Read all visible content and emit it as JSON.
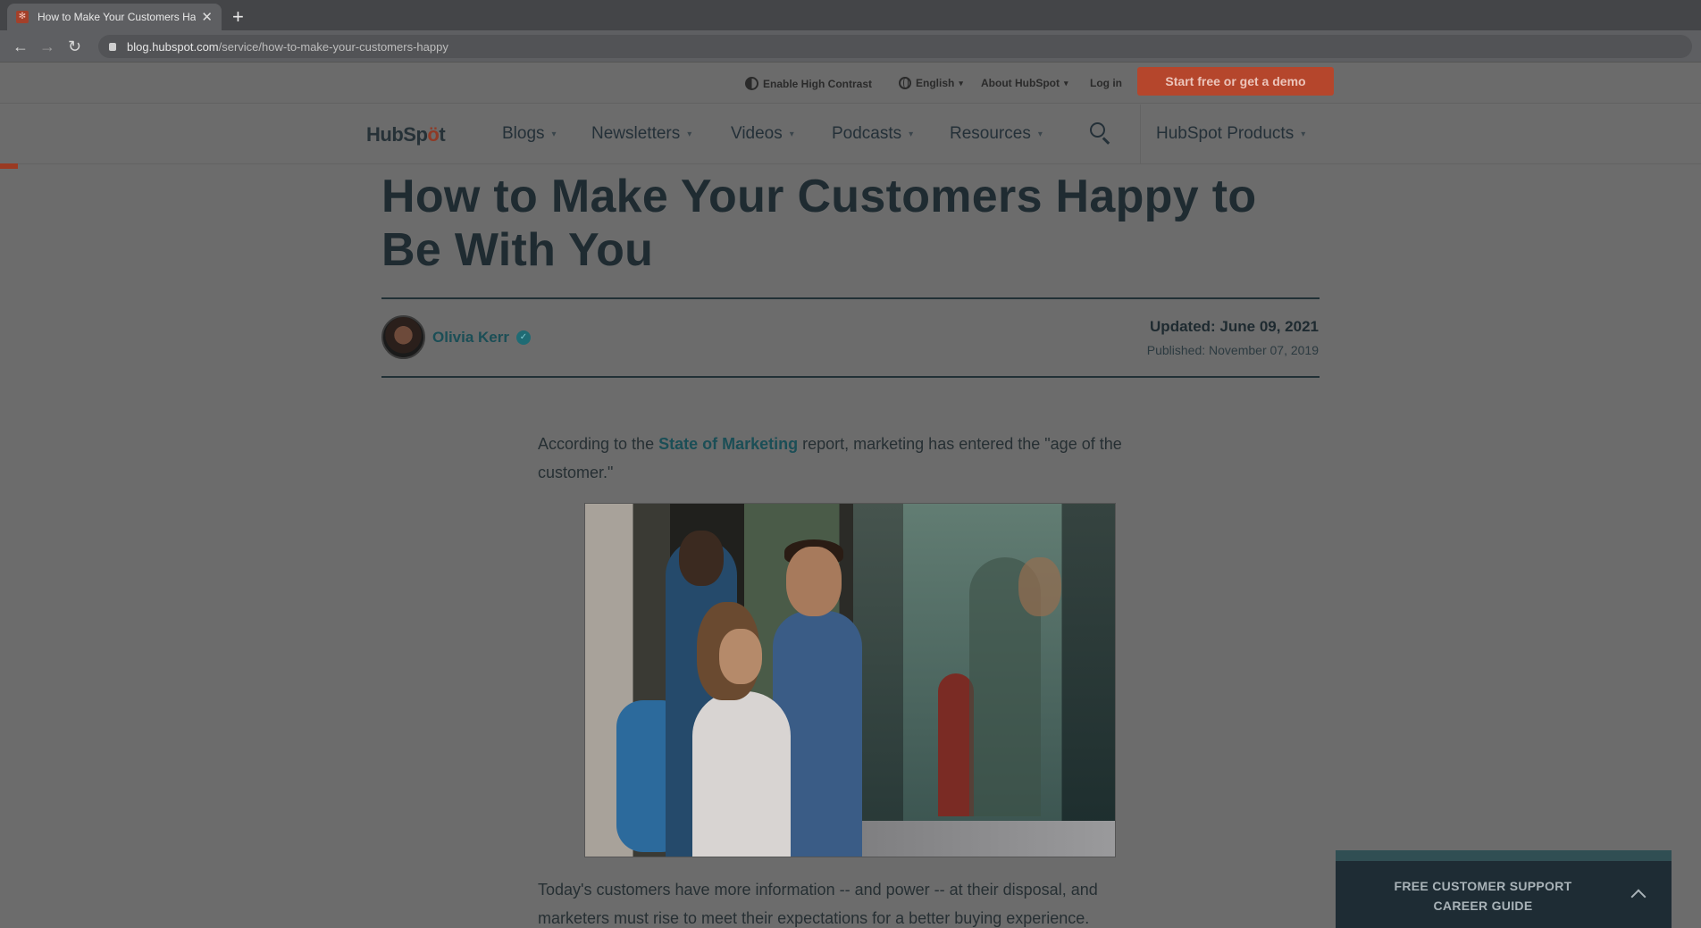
{
  "browser": {
    "tab_title": "How to Make Your Customers Happy to Be With You",
    "tab_title_visible": "How to Make Your Customers Ha",
    "url_domain": "blog.hubspot.com",
    "url_path": "/service/how-to-make-your-customers-happy",
    "icons": {
      "back": "back-arrow-icon",
      "forward": "forward-arrow-icon",
      "reload": "reload-icon",
      "new_tab": "plus-icon",
      "close": "close-icon",
      "lock": "lock-icon"
    }
  },
  "utility_bar": {
    "high_contrast": "Enable High Contrast",
    "language": "English",
    "about": "About HubSpot",
    "login": "Log in",
    "cta": "Start free or get a demo"
  },
  "nav": {
    "logo": "HubSpot",
    "items": [
      {
        "label": "Blogs"
      },
      {
        "label": "Newsletters"
      },
      {
        "label": "Videos"
      },
      {
        "label": "Podcasts"
      },
      {
        "label": "Resources"
      }
    ],
    "products": "HubSpot Products"
  },
  "article": {
    "title": "How to Make Your Customers Happy to Be With You",
    "author": "Olivia Kerr",
    "updated": "Updated: June 09, 2021",
    "published": "Published: November 07, 2019",
    "para1_before": "According to the ",
    "para1_link": "State of Marketing",
    "para1_after": " report, marketing has entered the \"age of the customer.\"",
    "para2": "Today's customers have more information -- and power -- at their disposal, and marketers must rise to meet their expectations for a better buying experience."
  },
  "sticky_guide": {
    "label": "FREE CUSTOMER SUPPORT CAREER GUIDE"
  },
  "colors": {
    "accent": "#b5462c",
    "link": "#1b4e56",
    "text": "#1f2b31"
  }
}
